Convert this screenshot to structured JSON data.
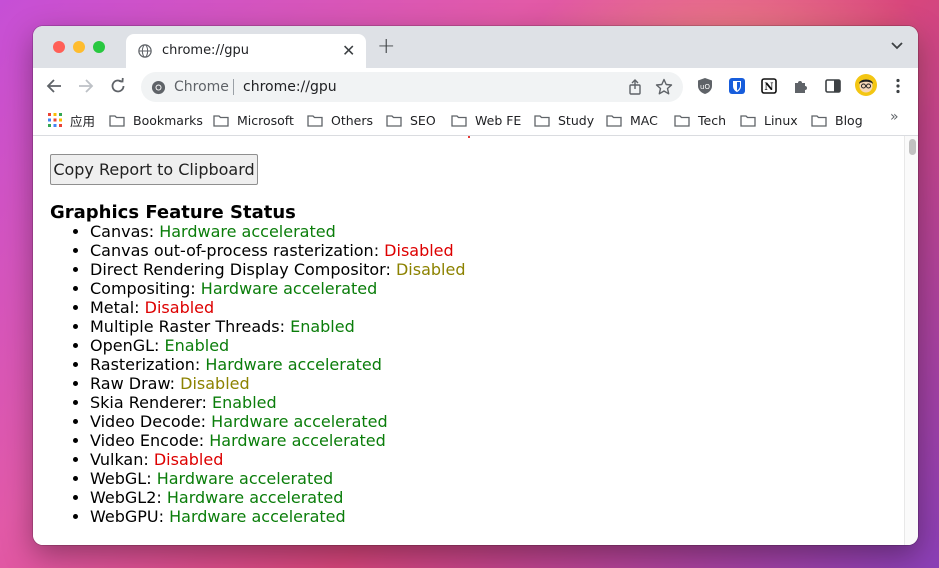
{
  "browser": {
    "tab": {
      "title": "chrome://gpu"
    },
    "omnibox": {
      "chip": "Chrome",
      "url": "chrome://gpu"
    }
  },
  "bookmarks": [
    {
      "label": "应用",
      "type": "apps"
    },
    {
      "label": "Bookmarks",
      "type": "folder"
    },
    {
      "label": "Microsoft",
      "type": "folder"
    },
    {
      "label": "Others",
      "type": "folder"
    },
    {
      "label": "SEO",
      "type": "folder"
    },
    {
      "label": "Web FE",
      "type": "folder"
    },
    {
      "label": "Study",
      "type": "folder"
    },
    {
      "label": "MAC",
      "type": "folder"
    },
    {
      "label": "Tech",
      "type": "folder"
    },
    {
      "label": "Linux",
      "type": "folder"
    },
    {
      "label": "Blog",
      "type": "folder"
    }
  ],
  "bookmarks_more": "»",
  "page": {
    "copy_button": "Copy Report to Clipboard",
    "section_title": "Graphics Feature Status",
    "features": [
      {
        "name": "Canvas",
        "status": "Hardware accelerated",
        "color": "#0a7d0a"
      },
      {
        "name": "Canvas out-of-process rasterization",
        "status": "Disabled",
        "color": "#dd0000"
      },
      {
        "name": "Direct Rendering Display Compositor",
        "status": "Disabled",
        "color": "#8c8200"
      },
      {
        "name": "Compositing",
        "status": "Hardware accelerated",
        "color": "#0a7d0a"
      },
      {
        "name": "Metal",
        "status": "Disabled",
        "color": "#dd0000"
      },
      {
        "name": "Multiple Raster Threads",
        "status": "Enabled",
        "color": "#0a7d0a"
      },
      {
        "name": "OpenGL",
        "status": "Enabled",
        "color": "#0a7d0a"
      },
      {
        "name": "Rasterization",
        "status": "Hardware accelerated",
        "color": "#0a7d0a"
      },
      {
        "name": "Raw Draw",
        "status": "Disabled",
        "color": "#8c8200"
      },
      {
        "name": "Skia Renderer",
        "status": "Enabled",
        "color": "#0a7d0a"
      },
      {
        "name": "Video Decode",
        "status": "Hardware accelerated",
        "color": "#0a7d0a"
      },
      {
        "name": "Video Encode",
        "status": "Hardware accelerated",
        "color": "#0a7d0a"
      },
      {
        "name": "Vulkan",
        "status": "Disabled",
        "color": "#dd0000"
      },
      {
        "name": "WebGL",
        "status": "Hardware accelerated",
        "color": "#0a7d0a"
      },
      {
        "name": "WebGL2",
        "status": "Hardware accelerated",
        "color": "#0a7d0a"
      },
      {
        "name": "WebGPU",
        "status": "Hardware accelerated",
        "color": "#0a7d0a"
      }
    ]
  },
  "icons": {
    "tab_favicon": "globe-icon",
    "omnibox": "chrome-icon",
    "share": "share-icon",
    "bookmark_star": "star-icon",
    "extensions": [
      "ublock-origin-icon",
      "bitwarden-icon",
      "notion-icon",
      "puzzle-extensions-icon",
      "side-panel-icon",
      "profile-avatar",
      "more-menu-icon"
    ]
  }
}
